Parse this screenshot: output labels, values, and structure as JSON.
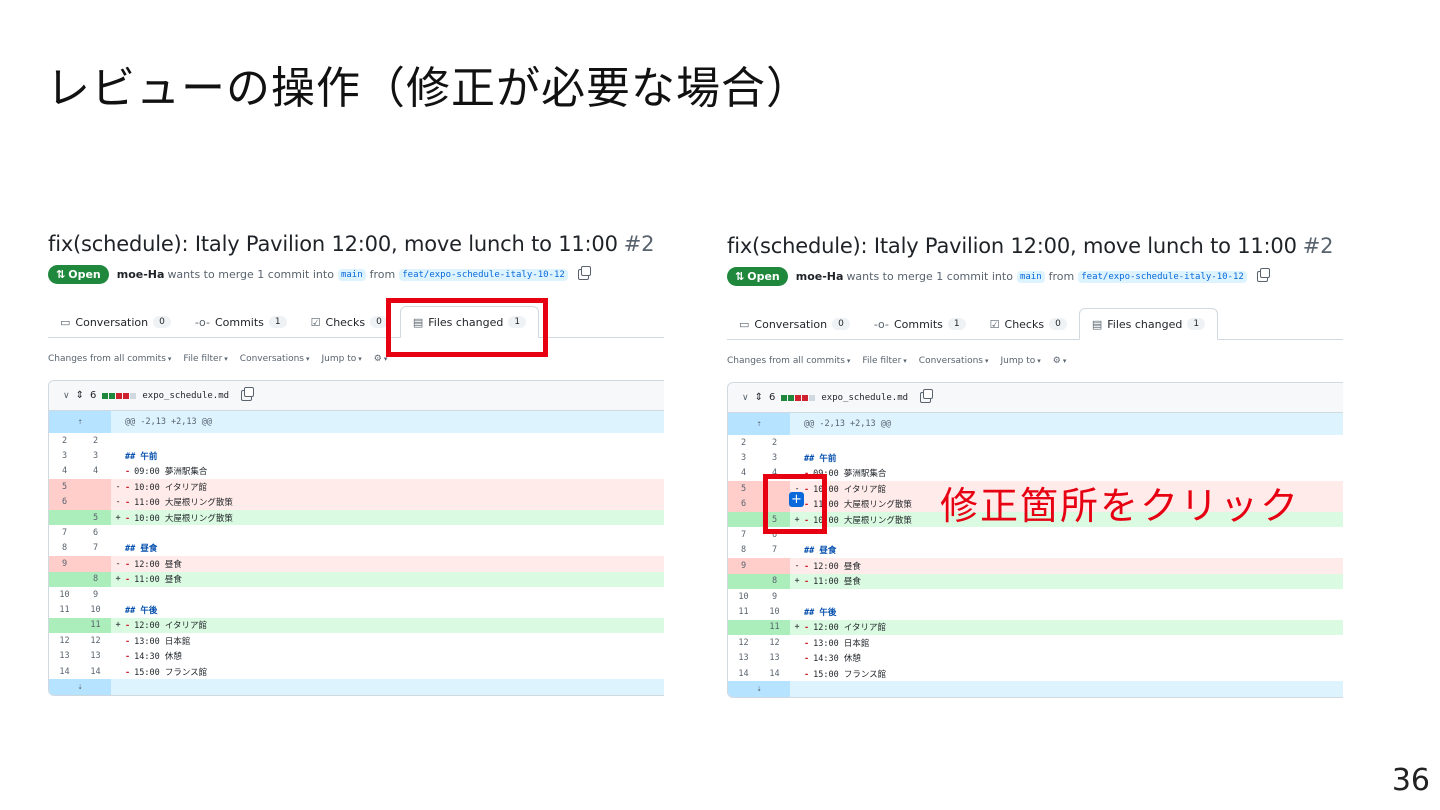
{
  "slide": {
    "title": "レビューの操作（修正が必要な場合）",
    "page_number": "36",
    "annotation": "修正箇所をクリック"
  },
  "pr": {
    "title": "fix(schedule): Italy Pavilion 12:00, move lunch to 11:00",
    "number": "#2",
    "status": "Open",
    "author": "moe-Ha",
    "merge_text": "wants to merge 1 commit into",
    "base_branch": "main",
    "from_text": "from",
    "head_branch": "feat/expo-schedule-italy-10-12"
  },
  "tabs": [
    {
      "label": "Conversation",
      "count": "0",
      "icon": "comment-icon"
    },
    {
      "label": "Commits",
      "count": "1",
      "icon": "commit-icon"
    },
    {
      "label": "Checks",
      "count": "0",
      "icon": "checklist-icon"
    },
    {
      "label": "Files changed",
      "count": "1",
      "icon": "file-diff-icon",
      "active": true
    }
  ],
  "toolbar": [
    "Changes from all commits",
    "File filter",
    "Conversations",
    "Jump to"
  ],
  "file": {
    "changes": "6",
    "name": "expo_schedule.md",
    "hunk_header": "@@ -2,13 +2,13 @@",
    "lines": [
      {
        "type": "ctx",
        "old": "2",
        "new": "2",
        "sign": "",
        "code": ""
      },
      {
        "type": "ctx",
        "old": "3",
        "new": "3",
        "sign": "",
        "code": "## 午前"
      },
      {
        "type": "ctx",
        "old": "4",
        "new": "4",
        "sign": "",
        "code": "- 09:00 夢洲駅集合"
      },
      {
        "type": "del",
        "old": "5",
        "new": "",
        "sign": "-",
        "code": "- 10:00 イタリア館"
      },
      {
        "type": "del",
        "old": "6",
        "new": "",
        "sign": "-",
        "code": "- 11:00 大屋根リング散策"
      },
      {
        "type": "add",
        "old": "",
        "new": "5",
        "sign": "+",
        "code": "- 10:00 大屋根リング散策"
      },
      {
        "type": "ctx",
        "old": "7",
        "new": "6",
        "sign": "",
        "code": ""
      },
      {
        "type": "ctx",
        "old": "8",
        "new": "7",
        "sign": "",
        "code": "## 昼食"
      },
      {
        "type": "del",
        "old": "9",
        "new": "",
        "sign": "-",
        "code": "- 12:00 昼食"
      },
      {
        "type": "add",
        "old": "",
        "new": "8",
        "sign": "+",
        "code": "- 11:00 昼食"
      },
      {
        "type": "ctx",
        "old": "10",
        "new": "9",
        "sign": "",
        "code": ""
      },
      {
        "type": "ctx",
        "old": "11",
        "new": "10",
        "sign": "",
        "code": "## 午後"
      },
      {
        "type": "add",
        "old": "",
        "new": "11",
        "sign": "+",
        "code": "- 12:00 イタリア館"
      },
      {
        "type": "ctx",
        "old": "12",
        "new": "12",
        "sign": "",
        "code": "- 13:00 日本館"
      },
      {
        "type": "ctx",
        "old": "13",
        "new": "13",
        "sign": "",
        "code": "- 14:30 休憩"
      },
      {
        "type": "ctx",
        "old": "14",
        "new": "14",
        "sign": "",
        "code": "- 15:00 フランス館"
      }
    ]
  },
  "colors": {
    "accent_red": "#e60012",
    "open_green": "#1f883d",
    "link_blue": "#0969da"
  }
}
